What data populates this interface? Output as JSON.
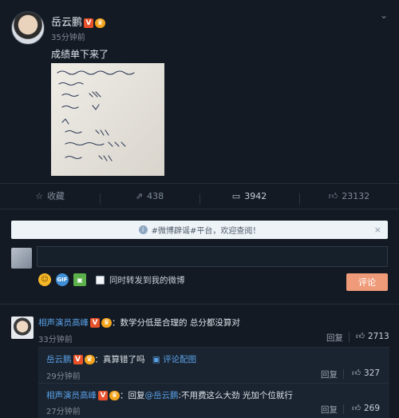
{
  "post": {
    "author": "岳云鹏",
    "badge_v": "V",
    "time": "35分钟前",
    "text": "成绩单下来了",
    "photo_caption_lines": [
      "河南 周口 怀阳 高考 成绩单",
      "岳恒鹏",
      "语文 134",
      "数学 99",
      "外语 145",
      "理科综合 288",
      "总分 702"
    ]
  },
  "actions": {
    "favorite": "收藏",
    "forward": "438",
    "comment": "3942",
    "like": "23132"
  },
  "notice": {
    "text": "#微博辟谣#平台，欢迎查阅！"
  },
  "composer": {
    "forward_label": "同时转发到我的微博",
    "submit": "评论",
    "gif_label": "GIF"
  },
  "comments": [
    {
      "author": "相声演员高峰",
      "text": "：数学分低是合理的 总分都没算对",
      "time": "33分钟前",
      "reply": "回复",
      "likes": "2713"
    }
  ],
  "subcomments": [
    {
      "author": "岳云鹏",
      "text": "：真算错了吗",
      "link": "评论配图",
      "time": "29分钟前",
      "reply": "回复",
      "likes": "327"
    },
    {
      "author": "相声演员高峰",
      "text_prefix": "：回复",
      "mention": "@岳云鹏",
      "text": ":不用费这么大劲 光加个位就行",
      "time": "27分钟前",
      "reply": "回复",
      "likes": "269"
    }
  ],
  "colors": {
    "background": "#131a24",
    "link": "#5aa0e6",
    "submit_button": "#ef9a78",
    "v_badge": "#e8512a"
  }
}
